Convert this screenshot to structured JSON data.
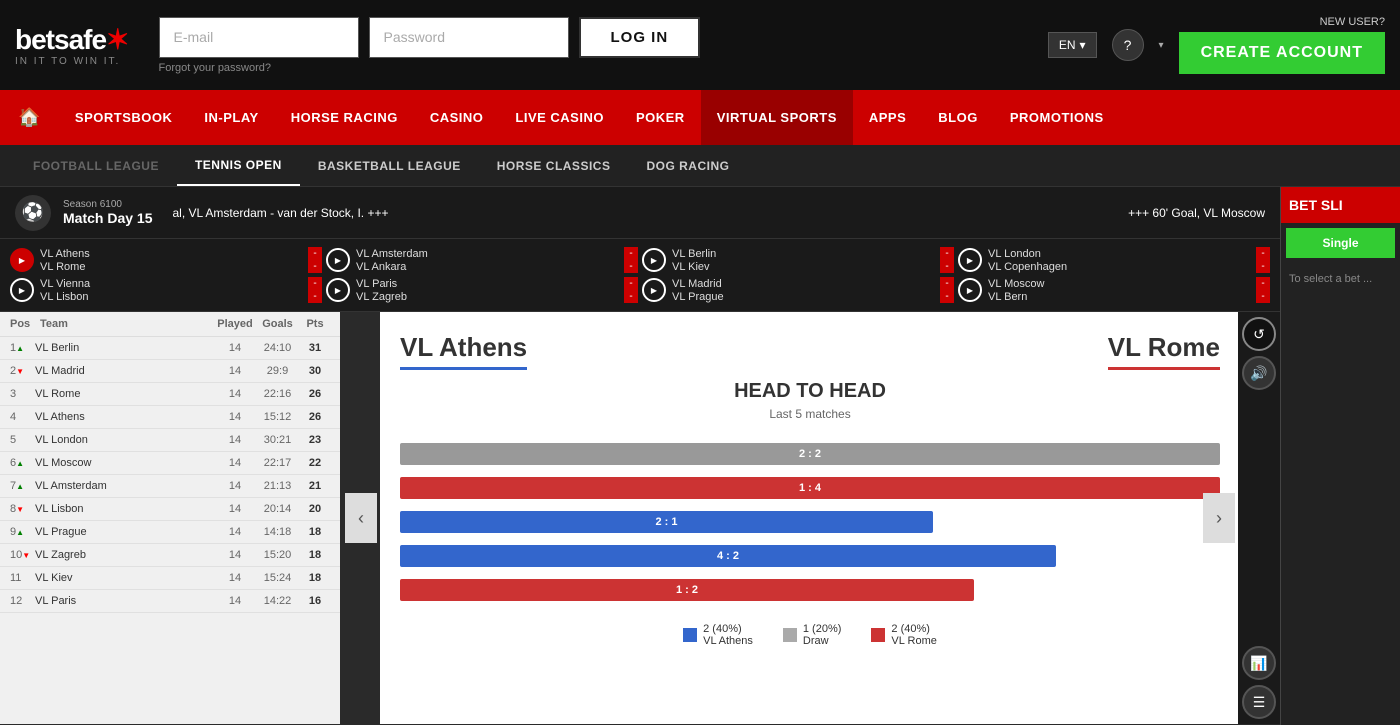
{
  "header": {
    "logo_text": "betsafe",
    "logo_tagline": "IN IT TO WIN IT.",
    "email_placeholder": "E-mail",
    "password_placeholder": "Password",
    "login_label": "LOG IN",
    "forgot_password": "Forgot your password?",
    "lang": "EN",
    "new_user_label": "NEW USER?",
    "create_account_label": "CREATE ACCOUNT"
  },
  "main_nav": {
    "items": [
      {
        "label": "🏠",
        "id": "home",
        "active": false
      },
      {
        "label": "SPORTSBOOK",
        "id": "sportsbook",
        "active": false
      },
      {
        "label": "IN-PLAY",
        "id": "inplay",
        "active": false
      },
      {
        "label": "HORSE RACING",
        "id": "horseracing",
        "active": false
      },
      {
        "label": "CASINO",
        "id": "casino",
        "active": false
      },
      {
        "label": "LIVE CASINO",
        "id": "livecasino",
        "active": false
      },
      {
        "label": "POKER",
        "id": "poker",
        "active": false
      },
      {
        "label": "VIRTUAL SPORTS",
        "id": "virtualsports",
        "active": true
      },
      {
        "label": "APPS",
        "id": "apps",
        "active": false
      },
      {
        "label": "BLOG",
        "id": "blog",
        "active": false
      },
      {
        "label": "PROMOTIONS",
        "id": "promotions",
        "active": false
      }
    ]
  },
  "sub_nav": {
    "items": [
      {
        "label": "FOOTBALL LEAGUE",
        "id": "football",
        "active": false,
        "dimmed": true
      },
      {
        "label": "TENNIS OPEN",
        "id": "tennis",
        "active": true
      },
      {
        "label": "BASKETBALL LEAGUE",
        "id": "basketball",
        "active": false
      },
      {
        "label": "HORSE CLASSICS",
        "id": "horseclassics",
        "active": false
      },
      {
        "label": "DOG RACING",
        "id": "dogracing",
        "active": false
      }
    ]
  },
  "ticker": {
    "season": "Season 6100",
    "matchday": "Match Day 15",
    "score_text": "al, VL Amsterdam - van der Stock, I. +++",
    "goal_text": "+++ 60' Goal, VL Moscow"
  },
  "matches": [
    {
      "team1": "VL Athens",
      "team2": "VL Rome",
      "score1": "-",
      "score2": "-",
      "active": true
    },
    {
      "team1": "VL Amsterdam",
      "team2": "VL Ankara",
      "score1": "-",
      "score2": "-",
      "active": false
    },
    {
      "team1": "VL Berlin",
      "team2": "VL Kiev",
      "score1": "-",
      "score2": "-",
      "active": false
    },
    {
      "team1": "VL London",
      "team2": "VL Copenhagen",
      "score1": "-",
      "score2": "-",
      "active": false
    },
    {
      "team1": "VL Vienna",
      "team2": "VL Lisbon",
      "score1": "-",
      "score2": "-",
      "active": false
    },
    {
      "team1": "VL Paris",
      "team2": "VL Zagreb",
      "score1": "-",
      "score2": "-",
      "active": false
    },
    {
      "team1": "VL Madrid",
      "team2": "VL Prague",
      "score1": "-",
      "score2": "-",
      "active": false
    },
    {
      "team1": "VL Moscow",
      "team2": "VL Bern",
      "score1": "-",
      "score2": "-",
      "active": false
    }
  ],
  "table": {
    "headers": [
      "Pos",
      "Team",
      "Played",
      "Goals",
      "Pts"
    ],
    "rows": [
      {
        "pos": "1",
        "arrow": "up",
        "team": "VL Berlin",
        "played": "14",
        "goals": "24:10",
        "pts": "31"
      },
      {
        "pos": "2",
        "arrow": "down",
        "team": "VL Madrid",
        "played": "14",
        "goals": "29:9",
        "pts": "30"
      },
      {
        "pos": "3",
        "arrow": "",
        "team": "VL Rome",
        "played": "14",
        "goals": "22:16",
        "pts": "26"
      },
      {
        "pos": "4",
        "arrow": "",
        "team": "VL Athens",
        "played": "14",
        "goals": "15:12",
        "pts": "26"
      },
      {
        "pos": "5",
        "arrow": "",
        "team": "VL London",
        "played": "14",
        "goals": "30:21",
        "pts": "23"
      },
      {
        "pos": "6",
        "arrow": "up",
        "team": "VL Moscow",
        "played": "14",
        "goals": "22:17",
        "pts": "22"
      },
      {
        "pos": "7",
        "arrow": "up",
        "team": "VL Amsterdam",
        "played": "14",
        "goals": "21:13",
        "pts": "21"
      },
      {
        "pos": "8",
        "arrow": "down",
        "team": "VL Lisbon",
        "played": "14",
        "goals": "20:14",
        "pts": "20"
      },
      {
        "pos": "9",
        "arrow": "up",
        "team": "VL Prague",
        "played": "14",
        "goals": "14:18",
        "pts": "18"
      },
      {
        "pos": "10",
        "arrow": "down",
        "team": "VL Zagreb",
        "played": "14",
        "goals": "15:20",
        "pts": "18"
      },
      {
        "pos": "11",
        "arrow": "",
        "team": "VL Kiev",
        "played": "14",
        "goals": "15:24",
        "pts": "18"
      },
      {
        "pos": "12",
        "arrow": "",
        "team": "VL Paris",
        "played": "14",
        "goals": "14:22",
        "pts": "16"
      }
    ]
  },
  "h2h": {
    "team1": "VL Athens",
    "team2": "VL Rome",
    "title": "HEAD TO HEAD",
    "subtitle": "Last 5 matches",
    "bars": [
      {
        "label": "2 : 2",
        "team1_width": 50,
        "team2_width": 50,
        "type": "draw"
      },
      {
        "label": "1 : 4",
        "team1_width": 20,
        "team2_width": 80,
        "type": "team2"
      },
      {
        "label": "2 : 1",
        "team1_width": 65,
        "team2_width": 35,
        "type": "team1"
      },
      {
        "label": "4 : 2",
        "team1_width": 70,
        "team2_width": 30,
        "type": "team1"
      },
      {
        "label": "1 : 2",
        "team1_width": 35,
        "team2_width": 65,
        "type": "team2"
      }
    ],
    "legend": [
      {
        "color": "blue",
        "label": "2 (40%)",
        "sublabel": "VL Athens"
      },
      {
        "color": "gray",
        "label": "1 (20%)",
        "sublabel": "Draw"
      },
      {
        "color": "red",
        "label": "2 (40%)",
        "sublabel": "VL Rome"
      }
    ]
  },
  "bet_slip": {
    "header": "BET SLI",
    "single_label": "Single",
    "select_text": "To select a bet ..."
  }
}
